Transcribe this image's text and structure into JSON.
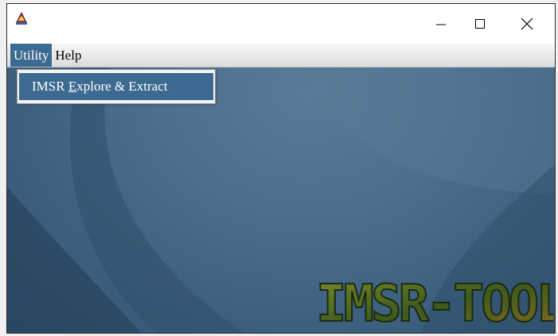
{
  "window": {
    "app_icon": "java-cup-icon",
    "controls": {
      "minimize_icon": "minimize-icon",
      "maximize_icon": "maximize-icon",
      "close_icon": "close-icon"
    }
  },
  "menubar": {
    "items": [
      {
        "label": "Utility"
      },
      {
        "label": "Help"
      }
    ]
  },
  "utility_menu": {
    "items": [
      {
        "prefix": "IMSR ",
        "mnemonic": "E",
        "suffix": "xplore & Extract"
      }
    ]
  },
  "background": {
    "logo_text": "IMSR-TOOL",
    "colors": {
      "desktop": "#3c5f7d",
      "menu_highlight": "#3d6a90"
    }
  }
}
